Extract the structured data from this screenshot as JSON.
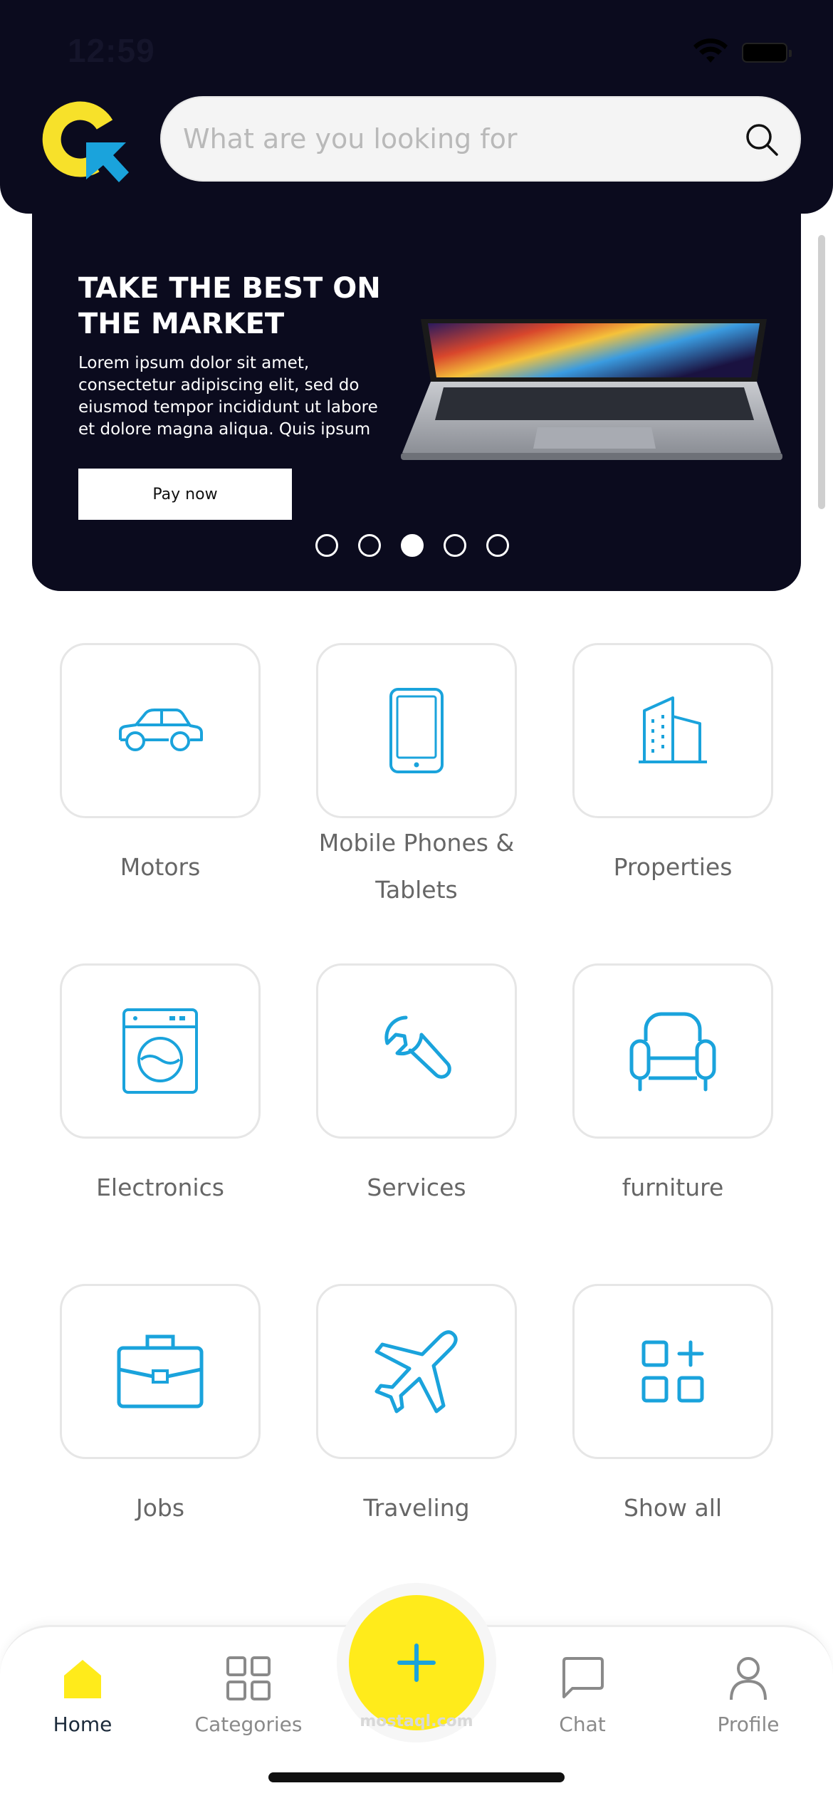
{
  "status_bar": {
    "time": "12:59"
  },
  "search": {
    "placeholder": "What are you looking for"
  },
  "banner": {
    "title": "TAKE THE BEST ON THE MARKET",
    "text": "Lorem ipsum dolor sit amet, consectetur adipiscing elit, sed do eiusmod tempor incididunt ut labore et dolore magna aliqua. Quis ipsum",
    "button_label": "Pay now",
    "slide_count": 5,
    "active_slide": 3
  },
  "categories": [
    {
      "label": "Motors",
      "icon": "car-icon"
    },
    {
      "label": "Mobile Phones & Tablets",
      "icon": "phone-icon"
    },
    {
      "label": "Properties",
      "icon": "building-icon"
    },
    {
      "label": "Electronics",
      "icon": "washing-machine-icon"
    },
    {
      "label": "Services",
      "icon": "wrench-icon"
    },
    {
      "label": "furniture",
      "icon": "armchair-icon"
    },
    {
      "label": "Jobs",
      "icon": "briefcase-icon"
    },
    {
      "label": "Traveling",
      "icon": "airplane-icon"
    },
    {
      "label": "Show all",
      "icon": "grid-plus-icon"
    }
  ],
  "bottom_nav": {
    "items": [
      {
        "label": "Home",
        "icon": "home-icon",
        "active": true
      },
      {
        "label": "Categories",
        "icon": "grid-icon",
        "active": false
      },
      {
        "label": "Chat",
        "icon": "chat-icon",
        "active": false
      },
      {
        "label": "Profile",
        "icon": "user-icon",
        "active": false
      }
    ],
    "watermark": "mostaql.com"
  },
  "colors": {
    "header_bg": "#0b0b1e",
    "accent_yellow": "#ffeb1b",
    "icon_blue": "#1aa3dc",
    "logo_yellow": "#f7e12a"
  }
}
